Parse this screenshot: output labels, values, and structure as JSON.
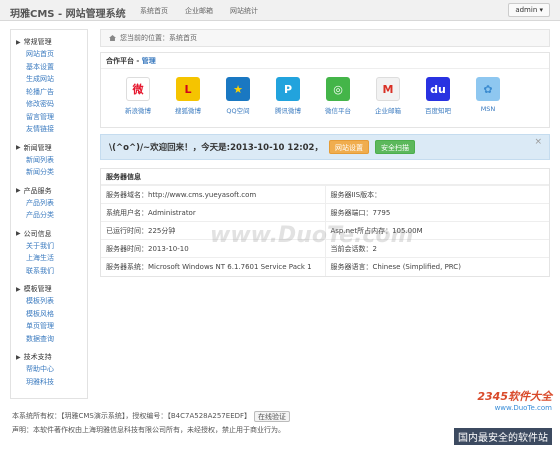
{
  "topbar": {
    "brand": "玥雅CMS - 网站管理系统",
    "nav": [
      "系统首页",
      "企业邮箱",
      "网站统计"
    ],
    "user": "admin ▾"
  },
  "sidebar": {
    "groups": [
      {
        "title": "常规管理",
        "items": [
          "网站首页",
          "基本设置",
          "生成网站",
          "轮播广告",
          "修改密码",
          "留言管理",
          "友情链接"
        ]
      },
      {
        "title": "新闻管理",
        "items": [
          "新闻列表",
          "新闻分类"
        ]
      },
      {
        "title": "产品服务",
        "items": [
          "产品列表",
          "产品分类"
        ]
      },
      {
        "title": "公司信息",
        "items": [
          "关于我们",
          "上海生活",
          "联系我们"
        ]
      },
      {
        "title": "模板管理",
        "items": [
          "模板列表",
          "模板风格",
          "单页管理",
          "数据查询"
        ]
      },
      {
        "title": "技术支持",
        "items": [
          "帮助中心",
          "玥雅科技"
        ]
      }
    ]
  },
  "breadcrumb": "您当前的位置：系统首页",
  "partners": {
    "title": "合作平台 - ",
    "manage_link": "管理",
    "items": [
      {
        "label": "新浪微博",
        "icon": "weibo-icon",
        "color": "#ffffff",
        "glyph": "微",
        "fg": "#e6162d"
      },
      {
        "label": "搜狐微博",
        "icon": "sohu-weibo-icon",
        "color": "#f5c400",
        "glyph": "L",
        "fg": "#d0021b"
      },
      {
        "label": "QQ空间",
        "icon": "qzone-icon",
        "color": "#1a78c2",
        "glyph": "★",
        "fg": "#ffd200"
      },
      {
        "label": "腾讯微博",
        "icon": "tencent-weibo-icon",
        "color": "#22a3dd",
        "glyph": "P",
        "fg": "#ffffff"
      },
      {
        "label": "微信平台",
        "icon": "wechat-icon",
        "color": "#44b549",
        "glyph": "◎",
        "fg": "#ffffff"
      },
      {
        "label": "企业邮箱",
        "icon": "mail-icon",
        "color": "#f2f2f2",
        "glyph": "M",
        "fg": "#d93025"
      },
      {
        "label": "百度知吧",
        "icon": "baidu-icon",
        "color": "#2932e1",
        "glyph": "du",
        "fg": "#ffffff"
      },
      {
        "label": "MSN",
        "icon": "msn-icon",
        "color": "#8ec7f0",
        "glyph": "✿",
        "fg": "#3b8bd0"
      }
    ]
  },
  "welcome": {
    "text": "\\(^o^)/~欢迎回来！，今天是:2013-10-10 12:02，",
    "btn_settings": "网站设置",
    "btn_scan": "安全扫描",
    "close": "×"
  },
  "server": {
    "title": "服务器信息",
    "rows": [
      [
        "服务器域名：http://www.cms.yueyasoft.com",
        "服务器IIS版本："
      ],
      [
        "系统用户名：Administrator",
        "服务器端口：7795"
      ],
      [
        "已运行时间：225分钟",
        "Asp.net所占内存：105.00M"
      ],
      [
        "服务器时间：2013-10-10",
        "当前会话数：2"
      ],
      [
        "服务器系统：Microsoft Windows NT 6.1.7601 Service Pack 1",
        "服务器语言：Chinese (Simplified, PRC)"
      ]
    ]
  },
  "footer": {
    "license": "本系统所有权：【玥雅CMS演示系统】，授权编号：【B4C7A528A257EEDF】",
    "verify": "在线验证",
    "statement": "声明：本软件著作权由上海玥雅信息科技有限公司所有，未经授权，禁止用于商业行为。"
  },
  "watermarks": {
    "center": "www.DuoTe.com",
    "corner_top": "2345软件大全",
    "corner_url": "www.DuoTe.com",
    "corner_bottom": "国内最安全的软件站"
  }
}
